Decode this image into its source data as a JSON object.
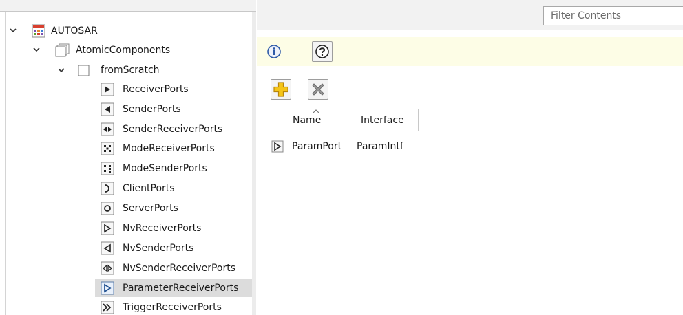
{
  "tree": {
    "root": {
      "label": "AUTOSAR",
      "icon": "autosar-tree-icon"
    },
    "level1": {
      "label": "AtomicComponents",
      "icon": "folder-pages-icon"
    },
    "level2": {
      "label": "fromScratch",
      "icon": "component-box-icon"
    },
    "items": [
      {
        "label": "ReceiverPorts",
        "icon": "receiver-port-icon"
      },
      {
        "label": "SenderPorts",
        "icon": "sender-port-icon"
      },
      {
        "label": "SenderReceiverPorts",
        "icon": "sender-receiver-port-icon"
      },
      {
        "label": "ModeReceiverPorts",
        "icon": "mode-receiver-port-icon"
      },
      {
        "label": "ModeSenderPorts",
        "icon": "mode-sender-port-icon"
      },
      {
        "label": "ClientPorts",
        "icon": "client-port-icon"
      },
      {
        "label": "ServerPorts",
        "icon": "server-port-icon"
      },
      {
        "label": "NvReceiverPorts",
        "icon": "nv-receiver-port-icon"
      },
      {
        "label": "NvSenderPorts",
        "icon": "nv-sender-port-icon"
      },
      {
        "label": "NvSenderReceiverPorts",
        "icon": "nv-sender-receiver-port-icon"
      },
      {
        "label": "ParameterReceiverPorts",
        "icon": "parameter-receiver-port-icon",
        "selected": true
      },
      {
        "label": "TriggerReceiverPorts",
        "icon": "trigger-receiver-port-icon"
      }
    ]
  },
  "filter": {
    "placeholder": "Filter Contents"
  },
  "infobar": {
    "icons": [
      "info-icon",
      "help-icon"
    ]
  },
  "toolbar": {
    "icons": [
      "add-icon",
      "delete-icon"
    ]
  },
  "table": {
    "columns": [
      "Name",
      "Interface"
    ],
    "sorted_column": "Name",
    "rows": [
      {
        "name": "ParamPort",
        "interface": "ParamIntf",
        "icon": "parameter-receiver-port-icon"
      }
    ]
  },
  "colors": {
    "selection": "#dcdcdc",
    "infobar_bg": "#fdfde6",
    "add_icon": "#f5c518",
    "panel_bg": "#f2f2f2"
  }
}
